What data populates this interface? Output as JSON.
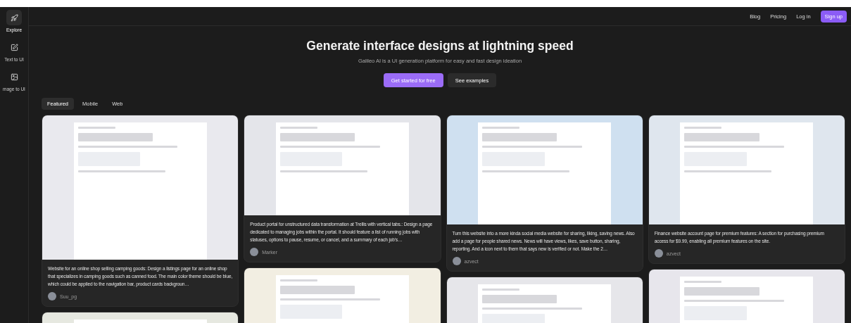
{
  "sidebar": {
    "items": [
      {
        "label": "Explore",
        "selected": true
      },
      {
        "label": "Text to UI",
        "selected": false
      },
      {
        "label": "mage to UI",
        "selected": false
      }
    ]
  },
  "header": {
    "links": [
      {
        "label": "Blog",
        "kind": "link"
      },
      {
        "label": "Pricing",
        "kind": "link"
      },
      {
        "label": "Log in",
        "kind": "link"
      },
      {
        "label": "Sign up",
        "kind": "button"
      }
    ]
  },
  "hero": {
    "title": "Generate interface designs at lightning speed",
    "subtitle": "Galileo AI is a UI generation platform for easy and fast design ideation",
    "buttons": [
      {
        "label": "Get started for free",
        "kind": "primary"
      },
      {
        "label": "See examples",
        "kind": "secondary"
      }
    ]
  },
  "tabs": [
    {
      "label": "Featured",
      "selected": true
    },
    {
      "label": "Mobile",
      "selected": false
    },
    {
      "label": "Web",
      "selected": false
    }
  ],
  "columns": [
    {
      "cards": [
        {
          "color": "#e9e9ee",
          "description": "Website for an online shop selling camping goods: Design a listings page for an online shop that specializes in camping goods such as canned food. The main color theme should be blue, which could be applied to the navigation bar, product cards backgroun…",
          "author": "Suu_pg"
        },
        {
          "color": "#e6e8e0"
        }
      ]
    },
    {
      "cards": [
        {
          "color": "#e4e5ea",
          "description": "Product portal for unstructured data transformation at Trellis with vertical tabs.: Design a page dedicated to managing jobs within the portal. It should feature a list of running jobs with statuses, options to pause, resume, or cancel, and a summary of each job's…",
          "author": "Marker"
        },
        {
          "color": "#f2eee2"
        }
      ]
    },
    {
      "cards": [
        {
          "color": "#cfe0f0",
          "description": "Turn this website into a more kinda social media website for sharing, liking, saving news. Also add a page for people shared news. News will have views, likes, save button, sharing, reporting. And a icon next to them that says new is verified or not. Make the 2…",
          "author": "azvect"
        },
        {
          "color": "#e6e6ea"
        }
      ]
    },
    {
      "cards": [
        {
          "color": "#dfe6ee",
          "description": "Finance website account page for premium features: A section for purchasing premium access for $9.99, enabling all premium features on the site.",
          "author": "azvect"
        },
        {
          "color": "#e7e6ec"
        }
      ]
    }
  ]
}
